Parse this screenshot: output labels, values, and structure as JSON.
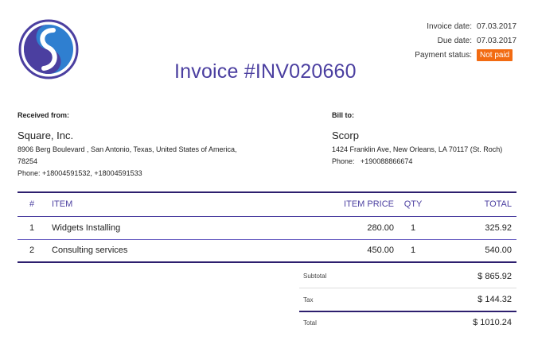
{
  "logo": {
    "icon": "s-logo-icon",
    "colors": {
      "ring": "#4b3fa0",
      "fill": "#2f7fd0"
    }
  },
  "meta": {
    "invoice_date_label": "Invoice date:",
    "invoice_date": "07.03.2017",
    "due_date_label": "Due date:",
    "due_date": "07.03.2017",
    "payment_status_label": "Payment status:",
    "payment_status": "Not paid",
    "status_color": "#f26b12"
  },
  "title": "Invoice #INV020660",
  "received_from": {
    "heading": "Received from:",
    "name": "Square, Inc.",
    "address": "8906 Berg Boulevard , San Antonio, Texas, United States of America, 78254",
    "phone": "Phone: +18004591532, +18004591533"
  },
  "bill_to": {
    "heading": "Bill to:",
    "name": "Scorp",
    "address": "1424 Franklin Ave, New Orleans, LA 70117 (St. Roch)",
    "phone": "Phone:   +190088866674"
  },
  "table": {
    "headers": {
      "num": "#",
      "item": "ITEM",
      "price": "ITEM PRICE",
      "qty": "QTY",
      "total": "TOTAL"
    },
    "rows": [
      {
        "num": "1",
        "item": "Widgets Installing",
        "price": "280.00",
        "qty": "1",
        "total": "325.92"
      },
      {
        "num": "2",
        "item": "Consulting services",
        "price": "450.00",
        "qty": "1",
        "total": "540.00"
      }
    ]
  },
  "totals": {
    "subtotal_label": "Subtotal",
    "subtotal": "$ 865.92",
    "tax_label": "Tax",
    "tax": "$ 144.32",
    "total_label": "Total",
    "total": "$ 1010.24"
  },
  "accent_color": "#4b3fa0"
}
